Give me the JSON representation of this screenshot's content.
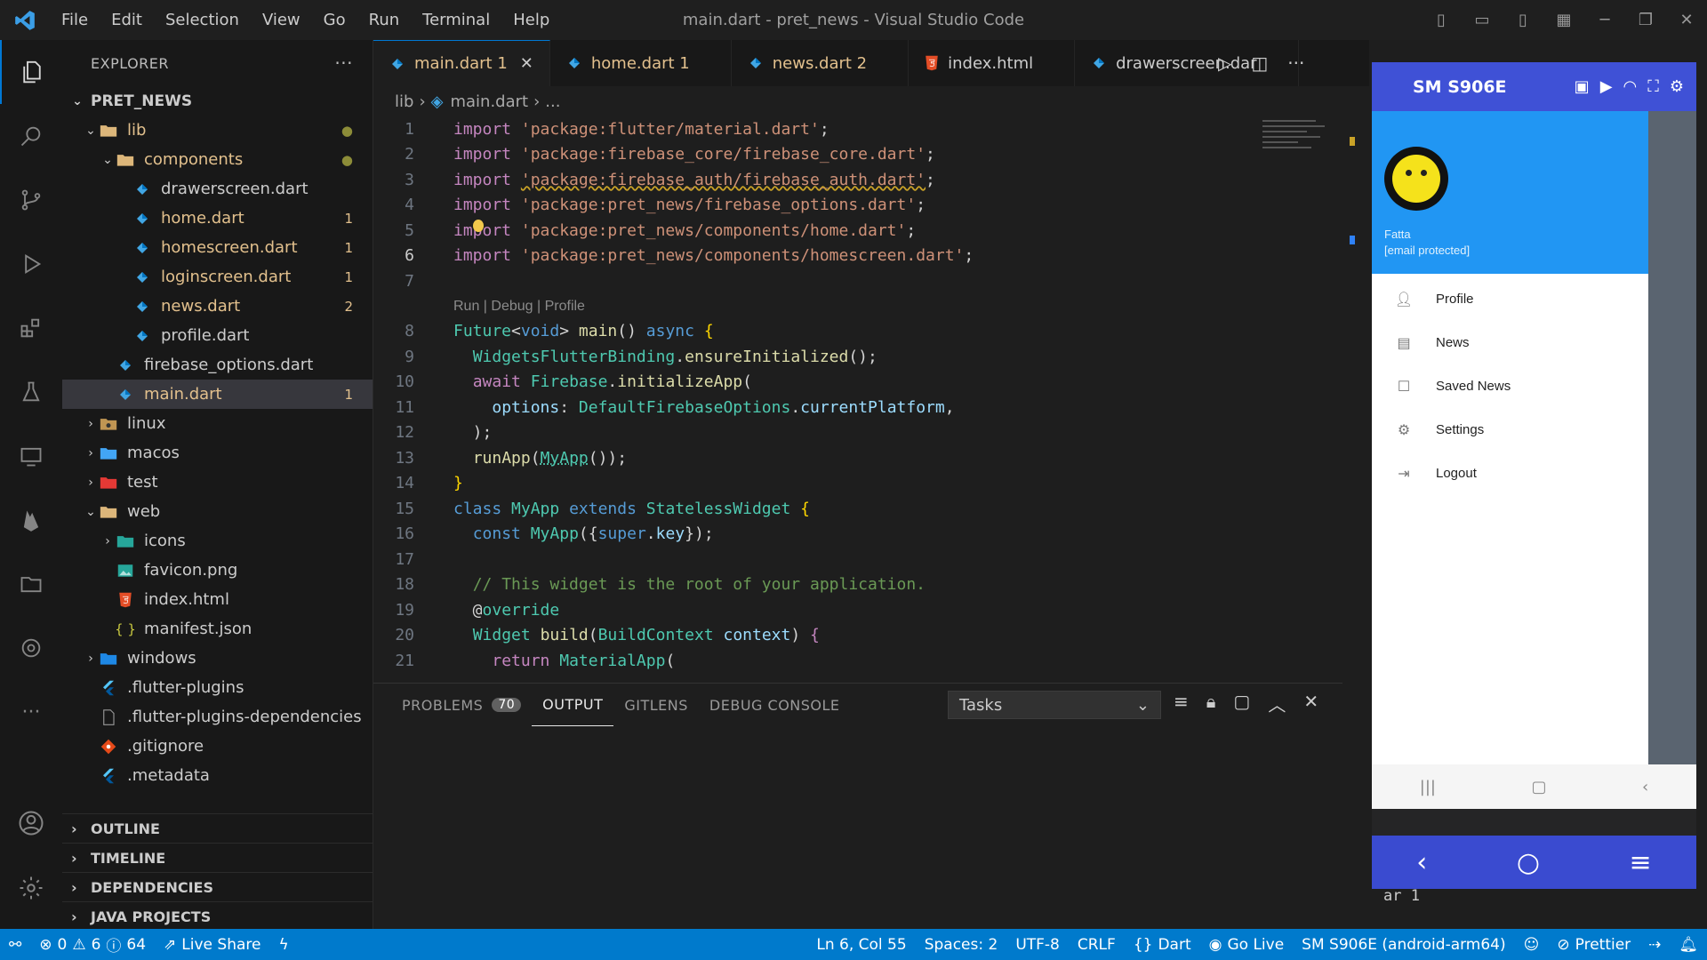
{
  "titlebar": {
    "menus": [
      "File",
      "Edit",
      "Selection",
      "View",
      "Go",
      "Run",
      "Terminal",
      "Help"
    ],
    "title": "main.dart - pret_news - Visual Studio Code"
  },
  "activity": [
    "explorer-icon",
    "search-icon",
    "source-control-icon",
    "run-debug-icon",
    "extensions-icon",
    "testing-icon",
    "remote-icon",
    "firebase-icon",
    "folder-icon",
    "gitlens-icon"
  ],
  "explorer": {
    "header": "EXPLORER",
    "more": "···",
    "project": "PRET_NEWS",
    "tree": [
      {
        "indent": 1,
        "chev": "v",
        "icon": "folder",
        "label": "lib",
        "color": "#e2c08d",
        "badge": "●",
        "badge_color": "#8c8c38"
      },
      {
        "indent": 2,
        "chev": "v",
        "icon": "folder",
        "label": "components",
        "color": "#e2c08d",
        "badge": "●",
        "badge_color": "#8c8c38"
      },
      {
        "indent": 3,
        "chev": "",
        "icon": "dart",
        "label": "drawerscreen.dart",
        "color": "#cccccc",
        "badge": "",
        "badge_color": ""
      },
      {
        "indent": 3,
        "chev": "",
        "icon": "dart",
        "label": "home.dart",
        "color": "#e2c08d",
        "badge": "1",
        "badge_color": "#e2c08d"
      },
      {
        "indent": 3,
        "chev": "",
        "icon": "dart",
        "label": "homescreen.dart",
        "color": "#e2c08d",
        "badge": "1",
        "badge_color": "#e2c08d"
      },
      {
        "indent": 3,
        "chev": "",
        "icon": "dart",
        "label": "loginscreen.dart",
        "color": "#e2c08d",
        "badge": "1",
        "badge_color": "#e2c08d"
      },
      {
        "indent": 3,
        "chev": "",
        "icon": "dart",
        "label": "news.dart",
        "color": "#e2c08d",
        "badge": "2",
        "badge_color": "#e2c08d"
      },
      {
        "indent": 3,
        "chev": "",
        "icon": "dart",
        "label": "profile.dart",
        "color": "#cccccc",
        "badge": "",
        "badge_color": ""
      },
      {
        "indent": 2,
        "chev": "",
        "icon": "dart",
        "label": "firebase_options.dart",
        "color": "#cccccc",
        "badge": "",
        "badge_color": ""
      },
      {
        "indent": 2,
        "chev": "",
        "icon": "dart",
        "label": "main.dart",
        "color": "#e2c08d",
        "badge": "1",
        "badge_color": "#e2c08d",
        "selected": true
      },
      {
        "indent": 1,
        "chev": ">",
        "icon": "folder-linux",
        "label": "linux",
        "color": "#cccccc",
        "badge": "",
        "badge_color": ""
      },
      {
        "indent": 1,
        "chev": ">",
        "icon": "folder-mac",
        "label": "macos",
        "color": "#cccccc",
        "badge": "",
        "badge_color": ""
      },
      {
        "indent": 1,
        "chev": ">",
        "icon": "folder-test",
        "label": "test",
        "color": "#cccccc",
        "badge": "",
        "badge_color": ""
      },
      {
        "indent": 1,
        "chev": "v",
        "icon": "folder",
        "label": "web",
        "color": "#cccccc",
        "badge": "",
        "badge_color": ""
      },
      {
        "indent": 2,
        "chev": ">",
        "icon": "folder-icons",
        "label": "icons",
        "color": "#cccccc",
        "badge": "",
        "badge_color": ""
      },
      {
        "indent": 2,
        "chev": "",
        "icon": "image",
        "label": "favicon.png",
        "color": "#cccccc",
        "badge": "",
        "badge_color": ""
      },
      {
        "indent": 2,
        "chev": "",
        "icon": "html",
        "label": "index.html",
        "color": "#cccccc",
        "badge": "",
        "badge_color": ""
      },
      {
        "indent": 2,
        "chev": "",
        "icon": "json",
        "label": "manifest.json",
        "color": "#cccccc",
        "badge": "",
        "badge_color": ""
      },
      {
        "indent": 1,
        "chev": ">",
        "icon": "folder-win",
        "label": "windows",
        "color": "#cccccc",
        "badge": "",
        "badge_color": ""
      },
      {
        "indent": 1,
        "chev": "",
        "icon": "flutter",
        "label": ".flutter-plugins",
        "color": "#cccccc",
        "badge": "",
        "badge_color": ""
      },
      {
        "indent": 1,
        "chev": "",
        "icon": "file",
        "label": ".flutter-plugins-dependencies",
        "color": "#cccccc",
        "badge": "",
        "badge_color": ""
      },
      {
        "indent": 1,
        "chev": "",
        "icon": "git",
        "label": ".gitignore",
        "color": "#cccccc",
        "badge": "",
        "badge_color": ""
      },
      {
        "indent": 1,
        "chev": "",
        "icon": "flutter",
        "label": ".metadata",
        "color": "#cccccc",
        "badge": "",
        "badge_color": ""
      }
    ],
    "sections": [
      "OUTLINE",
      "TIMELINE",
      "DEPENDENCIES",
      "JAVA PROJECTS"
    ]
  },
  "tabs": [
    {
      "label": "main.dart 1",
      "color": "#e2c08d",
      "icon": "dart",
      "active": true,
      "close": "✕"
    },
    {
      "label": "home.dart 1",
      "color": "#e2c08d",
      "icon": "dart",
      "active": false,
      "close": ""
    },
    {
      "label": "news.dart 2",
      "color": "#e2c08d",
      "icon": "dart",
      "active": false,
      "close": ""
    },
    {
      "label": "index.html",
      "color": "#cccccc",
      "icon": "html",
      "active": false,
      "close": ""
    },
    {
      "label": "drawerscreen.dar",
      "color": "#cccccc",
      "icon": "dart",
      "active": false,
      "close": ""
    }
  ],
  "breadcrumb": {
    "folder": "lib",
    "file": "main.dart",
    "rest": "..."
  },
  "codelens": "Run | Debug | Profile",
  "code": [
    {
      "n": "1",
      "html": "<span class='kw2'>import</span> <span class='str'>'package:flutter/material.dart'</span>;"
    },
    {
      "n": "2",
      "html": "<span class='kw2'>import</span> <span class='str'>'package:firebase_core/firebase_core.dart'</span>;"
    },
    {
      "n": "3",
      "html": "<span class='kw2'>import</span> <span class='str' style='text-decoration:underline wavy #c9a227'>'package:firebase_auth/firebase_auth.dart'</span>;"
    },
    {
      "n": "4",
      "html": "<span class='kw2'>import</span> <span class='str'>'package:pret_news/firebase_options.dart'</span>;"
    },
    {
      "n": "5",
      "html": "<span class='kw2'>import</span> <span class='str'>'package:pret_news/components/home.dart'</span>;"
    },
    {
      "n": "6",
      "html": "<span class='kw2'>import</span> <span class='str'>'package:pret_news/components/homescreen.dart'</span>;",
      "cur": true
    },
    {
      "n": "7",
      "html": ""
    },
    {
      "n": "8",
      "html": "<span class='ty'>Future</span>&lt;<span class='kw'>void</span>&gt; <span class='fn'>main</span>() <span class='kw'>async</span> <span class='pn'>{</span>"
    },
    {
      "n": "9",
      "html": "  <span class='ty'>WidgetsFlutterBinding</span>.<span class='fn'>ensureInitialized</span>();"
    },
    {
      "n": "10",
      "html": "  <span class='kw2'>await</span> <span class='ty'>Firebase</span>.<span class='fn'>initializeApp</span>("
    },
    {
      "n": "11",
      "html": "    <span class='va'>options</span>: <span class='ty'>DefaultFirebaseOptions</span>.<span class='va'>currentPlatform</span>,"
    },
    {
      "n": "12",
      "html": "  );"
    },
    {
      "n": "13",
      "html": "  <span class='fn'>runApp</span>(<span class='ty' style='text-decoration:underline dotted #4ec9b0'>MyApp</span>());"
    },
    {
      "n": "14",
      "html": "<span class='pn'>}</span>"
    },
    {
      "n": "15",
      "html": "<span class='kw'>class</span> <span class='ty'>MyApp</span> <span class='kw'>extends</span> <span class='ty'>StatelessWidget</span> <span class='pn'>{</span>"
    },
    {
      "n": "16",
      "html": "  <span class='kw'>const</span> <span class='ty'>MyApp</span>({<span class='kw'>super</span>.<span class='va'>key</span>});"
    },
    {
      "n": "17",
      "html": ""
    },
    {
      "n": "18",
      "html": "  <span class='cm'>// This widget is the root of your application.</span>"
    },
    {
      "n": "19",
      "html": "  @<span class='ty'>override</span>"
    },
    {
      "n": "20",
      "html": "  <span class='ty'>Widget</span> <span class='fn'>build</span>(<span class='ty'>BuildContext</span> <span class='va'>context</span>) <span class='kw2'>{</span>"
    },
    {
      "n": "21",
      "html": "    <span class='kw2'>return</span> <span class='ty'>MaterialApp</span>("
    }
  ],
  "panel": {
    "tabs": [
      "PROBLEMS",
      "OUTPUT",
      "GITLENS",
      "DEBUG CONSOLE"
    ],
    "problems_count": "70",
    "dropdown": "Tasks",
    "terminal_line": "ar 1"
  },
  "phone": {
    "device": "SM S906E",
    "user_name": "Fatta",
    "user_email": "[email protected]",
    "menu": [
      {
        "icon": "person",
        "label": "Profile"
      },
      {
        "icon": "news",
        "label": "News"
      },
      {
        "icon": "bookmark",
        "label": "Saved News"
      },
      {
        "icon": "gear",
        "label": "Settings"
      },
      {
        "icon": "logout",
        "label": "Logout"
      }
    ]
  },
  "status": {
    "errors": "0",
    "warnings": "6",
    "infos": "64",
    "liveshare": "Live Share",
    "position": "Ln 6, Col 55",
    "spaces": "Spaces: 2",
    "encoding": "UTF-8",
    "eol": "CRLF",
    "lang": "Dart",
    "golive": "Go Live",
    "device": "SM S906E (android-arm64)",
    "prettier": "Prettier"
  },
  "colors": {
    "accent": "#007acc",
    "phone_bar": "#3f51d6",
    "drawer": "#2196f3"
  }
}
